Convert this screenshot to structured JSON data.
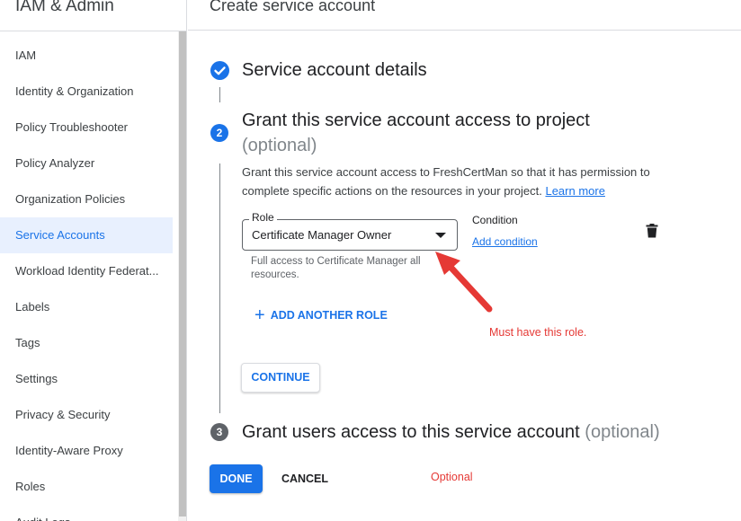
{
  "sidebar": {
    "title": "IAM & Admin",
    "items": [
      {
        "label": "IAM"
      },
      {
        "label": "Identity & Organization"
      },
      {
        "label": "Policy Troubleshooter"
      },
      {
        "label": "Policy Analyzer"
      },
      {
        "label": "Organization Policies"
      },
      {
        "label": "Service Accounts",
        "active": true
      },
      {
        "label": "Workload Identity Federat..."
      },
      {
        "label": "Labels"
      },
      {
        "label": "Tags"
      },
      {
        "label": "Settings"
      },
      {
        "label": "Privacy & Security"
      },
      {
        "label": "Identity-Aware Proxy"
      },
      {
        "label": "Roles"
      },
      {
        "label": "Audit Logs"
      }
    ]
  },
  "header": {
    "title": "Create service account"
  },
  "steps": {
    "step1": {
      "title": "Service account details"
    },
    "step2": {
      "number": "2",
      "title": "Grant this service account access to project",
      "optional": "(optional)",
      "description": "Grant this service account access to FreshCertMan so that it has permission to complete specific actions on the resources in your project.",
      "learn_more": "Learn more",
      "role_label": "Role",
      "role_value": "Certificate Manager Owner",
      "role_help": "Full access to Certificate Manager all resources.",
      "condition_label": "Condition",
      "add_condition": "Add condition",
      "add_another_role": "ADD ANOTHER ROLE",
      "continue": "CONTINUE"
    },
    "step3": {
      "number": "3",
      "title": "Grant users access to this service account",
      "optional": "(optional)"
    }
  },
  "actions": {
    "done": "DONE",
    "cancel": "CANCEL"
  },
  "annotations": {
    "must_have": "Must have this role.",
    "optional": "Optional"
  },
  "colors": {
    "accent": "#1a73e8",
    "annotation": "#e53935"
  }
}
